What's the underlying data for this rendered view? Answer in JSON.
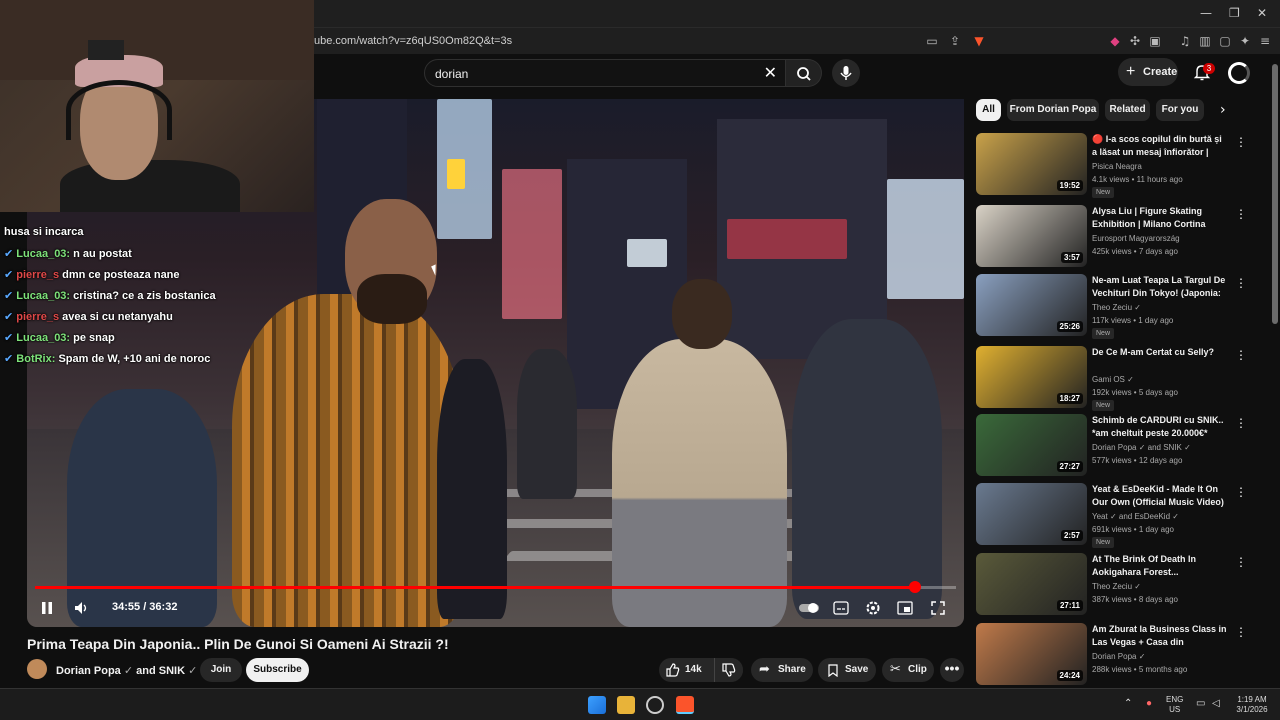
{
  "browser": {
    "url": "ube.com/watch?v=z6qUS0Om82Q&t=3s",
    "window_controls": [
      "—",
      "❐",
      "✕"
    ]
  },
  "header": {
    "search_value": "dorian",
    "create_label": "Create",
    "notification_count": "3"
  },
  "stream_chat": [
    {
      "prefix": "",
      "name": "",
      "text": "husa si incarca",
      "name_color": "none"
    },
    {
      "prefix": "✔",
      "name": "Lucaa_03:",
      "text": " n au postat",
      "name_color": "green"
    },
    {
      "prefix": "✔",
      "name": "pierre_s",
      "text": " dmn ce posteaza nane",
      "name_color": "red"
    },
    {
      "prefix": "✔",
      "name": "Lucaa_03:",
      "text": " cristina? ce a zis bostanica",
      "name_color": "green"
    },
    {
      "prefix": "✔",
      "name": "pierre_s",
      "text": " avea si cu netanyahu",
      "name_color": "red"
    },
    {
      "prefix": "✔",
      "name": "Lucaa_03:",
      "text": " pe snap",
      "name_color": "green"
    },
    {
      "prefix": "✔",
      "name": "BotRix:",
      "text": " Spam de W, +10 ani de noroc",
      "name_color": "green"
    }
  ],
  "player": {
    "time": "34:55 / 36:32",
    "progress_fraction": 0.956
  },
  "video": {
    "title": "Prima Teapa Din Japonia.. Plin De Gunoi Si Oameni Ai Strazii ?!",
    "channel": "Dorian Popa",
    "collab": "and SNIK",
    "join_label": "Join",
    "subscribe_label": "Subscribe",
    "likes": "14k",
    "share_label": "Share",
    "save_label": "Save",
    "clip_label": "Clip"
  },
  "chips": [
    "All",
    "From Dorian Popa",
    "Related",
    "For you"
  ],
  "recommendations": [
    {
      "title": "🔴 I-a scos copilul din burtă și a lăsat un mesaj înfiorător | Cri...",
      "channel": "Pisica Neagra",
      "meta": "4.1k views • 11 hours ago",
      "duration": "19:52",
      "new": "New",
      "thumb_color": "#c9a24a"
    },
    {
      "title": "Alysa Liu | Figure Skating Exhibition | Milano Cortina 2026",
      "channel": "Eurosport Magyarország",
      "meta": "425k views • 7 days ago",
      "duration": "3:57",
      "new": "",
      "thumb_color": "#d9d2c6"
    },
    {
      "title": "Ne-am Luat Teapa La Targul De Vechituri Din Tokyo! (Japonia: ...",
      "channel": "Theo Zeciu ✓",
      "meta": "117k views • 1 day ago",
      "duration": "25:26",
      "new": "New",
      "thumb_color": "#8aa0c0"
    },
    {
      "title": "De Ce M-am Certat cu Selly?",
      "channel": "Gami OS ✓",
      "meta": "192k views • 5 days ago",
      "duration": "18:27",
      "new": "New",
      "thumb_color": "#e0b030"
    },
    {
      "title": "Schimb de CARDURI cu SNIK.. *am cheltuit peste 20.000€*",
      "channel": "Dorian Popa ✓ and SNIK ✓",
      "meta": "577k views • 12 days ago",
      "duration": "27:27",
      "new": "",
      "thumb_color": "#3a6a3a"
    },
    {
      "title": "Yeat & EsDeeKid - Made It On Our Own (Official Music Video)",
      "channel": "Yeat ✓ and EsDeeKid ✓",
      "meta": "691k views • 1 day ago",
      "duration": "2:57",
      "new": "New",
      "thumb_color": "#6a7a90"
    },
    {
      "title": "At The Brink Of Death In Aokigahara Forest...",
      "channel": "Theo Zeciu ✓",
      "meta": "387k views • 8 days ago",
      "duration": "27:11",
      "new": "",
      "thumb_color": "#5a5a3a"
    },
    {
      "title": "Am Zburat la Business Class in Las Vegas + Casa din America...",
      "channel": "Dorian Popa ✓",
      "meta": "288k views • 5 months ago",
      "duration": "24:24",
      "new": "",
      "thumb_color": "#c07a4a"
    }
  ],
  "taskbar": {
    "lang_top": "ENG",
    "lang_bottom": "US",
    "time": "1:19 AM",
    "date": "3/1/2026"
  }
}
